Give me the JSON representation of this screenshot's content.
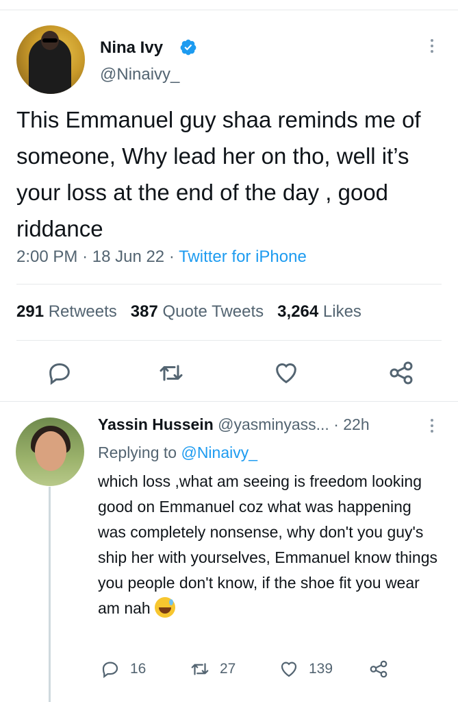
{
  "tweet": {
    "author_name": "Nina Ivy",
    "verified": true,
    "author_handle": "@Ninaivy_",
    "text": "This Emmanuel guy shaa reminds me of someone, Why lead her on tho, well it’s your loss at the end of the day , good riddance",
    "time": "2:00 PM",
    "sep1": "·",
    "date": "18 Jun 22",
    "sep2": "·",
    "source": "Twitter for iPhone",
    "retweets_count": "291",
    "retweets_label": "Retweets",
    "quotes_count": "387",
    "quotes_label": "Quote Tweets",
    "likes_count": "3,264",
    "likes_label": "Likes",
    "icons": [
      "reply-icon",
      "retweet-icon",
      "like-icon",
      "share-icon"
    ]
  },
  "reply": {
    "author_name": "Yassin Hussein",
    "author_handle": "@yasminyass...",
    "sep": "·",
    "time_ago": "22h",
    "replying_prefix": "Replying to",
    "replying_handle": "@Ninaivy_",
    "text": "which loss ,what am seeing is freedom looking good on Emmanuel  coz what was happening was completely nonsense, why don't you guy's ship her with yourselves, Emmanuel know things you people don't know, if the shoe fit you wear am nah",
    "emoji": "grinning-face-with-sweat",
    "reply_count": "16",
    "retweet_count": "27",
    "like_count": "139"
  },
  "colors": {
    "accent": "#1d9bf0",
    "secondary_text": "#536471",
    "primary_text": "#0f1419",
    "divider": "#e6e9eb"
  }
}
